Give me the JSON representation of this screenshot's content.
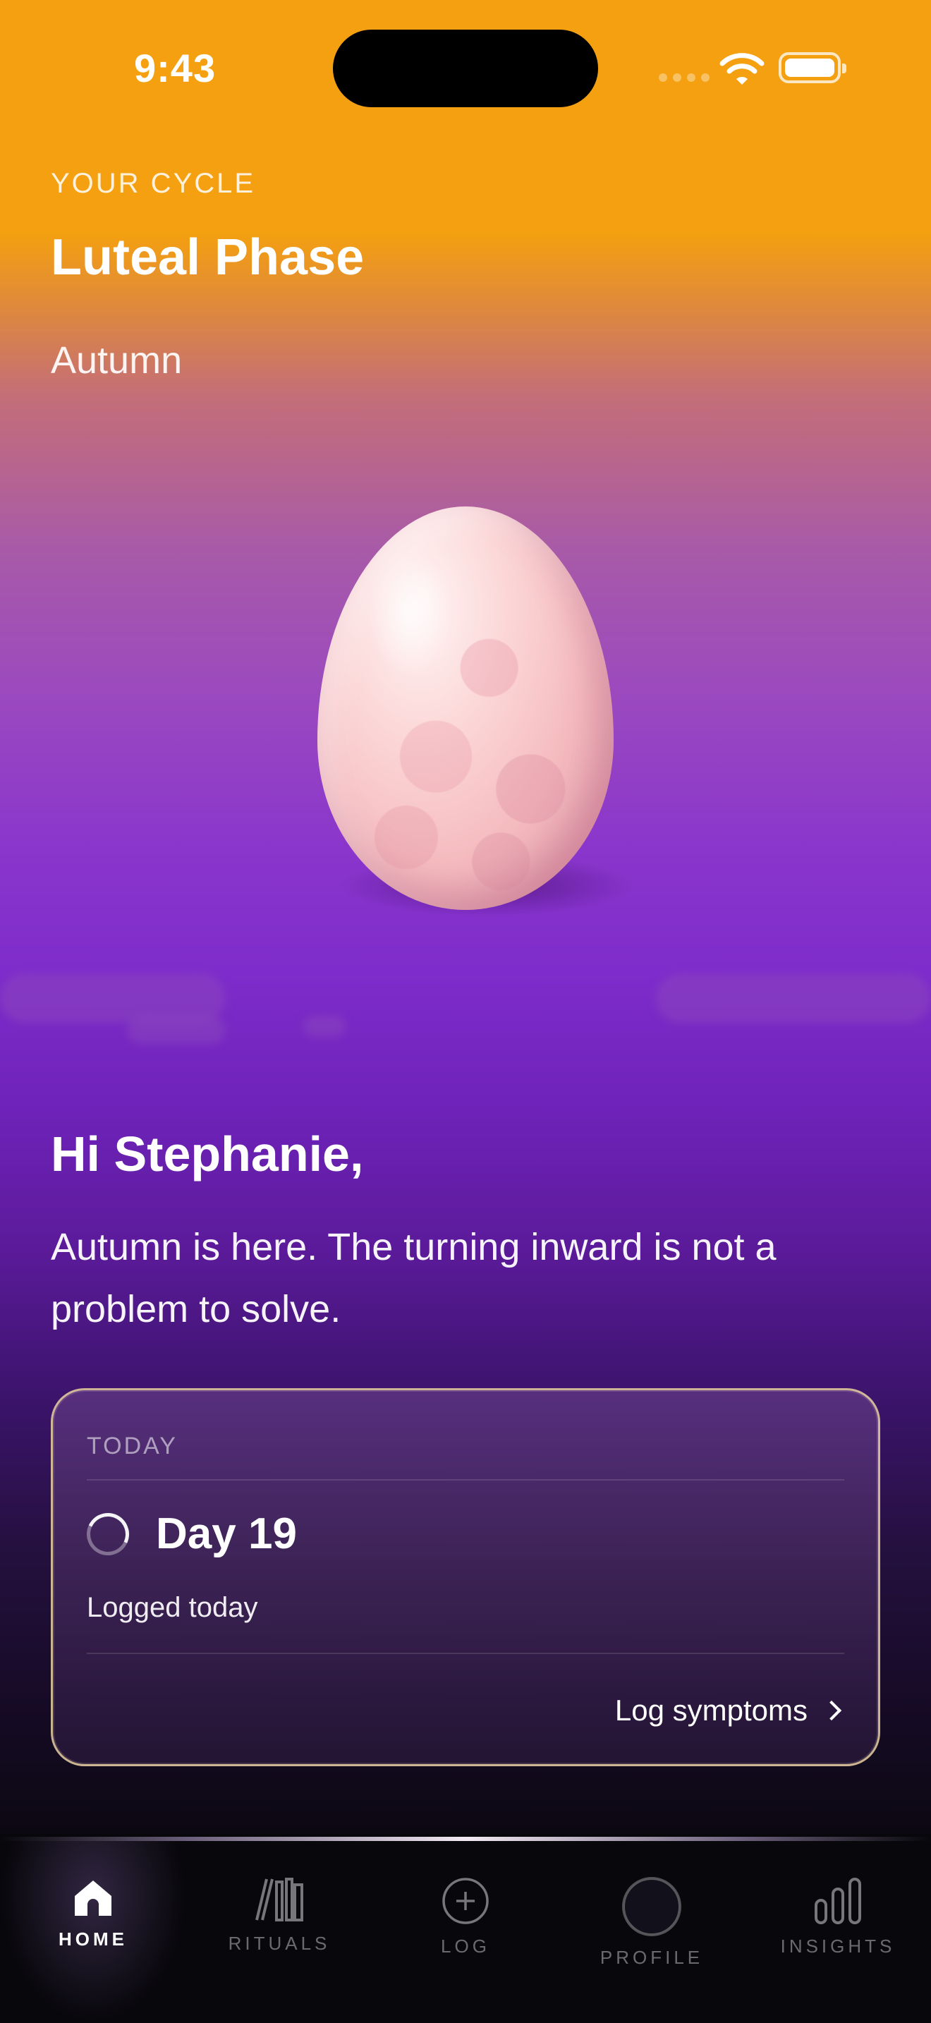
{
  "status_bar": {
    "time": "9:43"
  },
  "header": {
    "eyebrow": "YOUR CYCLE",
    "phase": "Luteal Phase",
    "season": "Autumn"
  },
  "greeting": {
    "title": "Hi Stephanie,",
    "message": "Autumn is here. The turning inward is not a problem to solve."
  },
  "today_card": {
    "label": "TODAY",
    "day": "Day 19",
    "status": "Logged today",
    "action": "Log symptoms"
  },
  "tabbar": {
    "items": [
      {
        "label": "HOME",
        "icon": "home-icon",
        "active": true
      },
      {
        "label": "RITUALS",
        "icon": "books-icon",
        "active": false
      },
      {
        "label": "LOG",
        "icon": "plus-circle-icon",
        "active": false
      },
      {
        "label": "PROFILE",
        "icon": "profile-circle-icon",
        "active": false
      },
      {
        "label": "INSIGHTS",
        "icon": "bar-chart-icon",
        "active": false
      }
    ]
  },
  "colors": {
    "top_orange": "#f4a010",
    "mid_purple": "#8a36cc",
    "card_border": "#e8d0a0",
    "tabbar_bg": "#08070b"
  }
}
